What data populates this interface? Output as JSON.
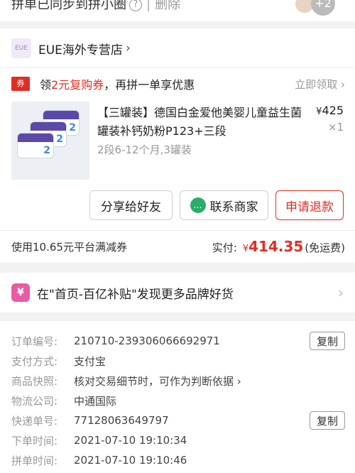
{
  "top": {
    "text": "拼单已同步到拼小圈",
    "help_icon": "?",
    "separator": "|",
    "delete_label": "删除",
    "more_count": "+2"
  },
  "store": {
    "logo_text": "EUE",
    "name": "EUE海外专营店",
    "chevron": "›"
  },
  "coupon": {
    "tag": "券",
    "text_pre": "领",
    "text_highlight": "2元复购券",
    "text_post": "，再拼一单享优惠",
    "claim_label": "立即领取 ›"
  },
  "product": {
    "title": "【三罐装】德国白金爱他美婴儿童益生菌罐装补钙奶粉P123+三段",
    "spec": "2段6-12个月,3罐装",
    "currency": "¥",
    "price": "425",
    "quantity": "×1",
    "can_label": "2"
  },
  "actions": {
    "share": "分享给好友",
    "contact": "联系商家",
    "refund": "申请退款"
  },
  "summary": {
    "discount": "使用10.65元平台满减券",
    "paid_label": "实付:",
    "currency": "¥",
    "paid_amount": "414.35",
    "shipping": "(免运费)"
  },
  "promo": {
    "icon_text": "¥",
    "text": "在\"首页-百亿补贴\"发现更多品牌好货",
    "chevron": "›"
  },
  "order": {
    "copy_label": "复制",
    "rows": [
      {
        "label": "订单编号:",
        "value": "210710-239306066692971"
      },
      {
        "label": "支付方式:",
        "value": "支付宝"
      },
      {
        "label": "商品快照:",
        "value": "核对交易细节时，可作为判断依据 ›"
      },
      {
        "label": "物流公司:",
        "value": "中通国际"
      },
      {
        "label": "快递单号:",
        "value": "77128063649797"
      },
      {
        "label": "下单时间:",
        "value": "2021-07-10 19:10:34"
      },
      {
        "label": "拼单时间:",
        "value": "2021-07-10 19:10:46"
      }
    ]
  },
  "colors": {
    "accent_red": "#e02e24",
    "wechat_green": "#2aae67",
    "promo_pink": "#e85ca6"
  }
}
